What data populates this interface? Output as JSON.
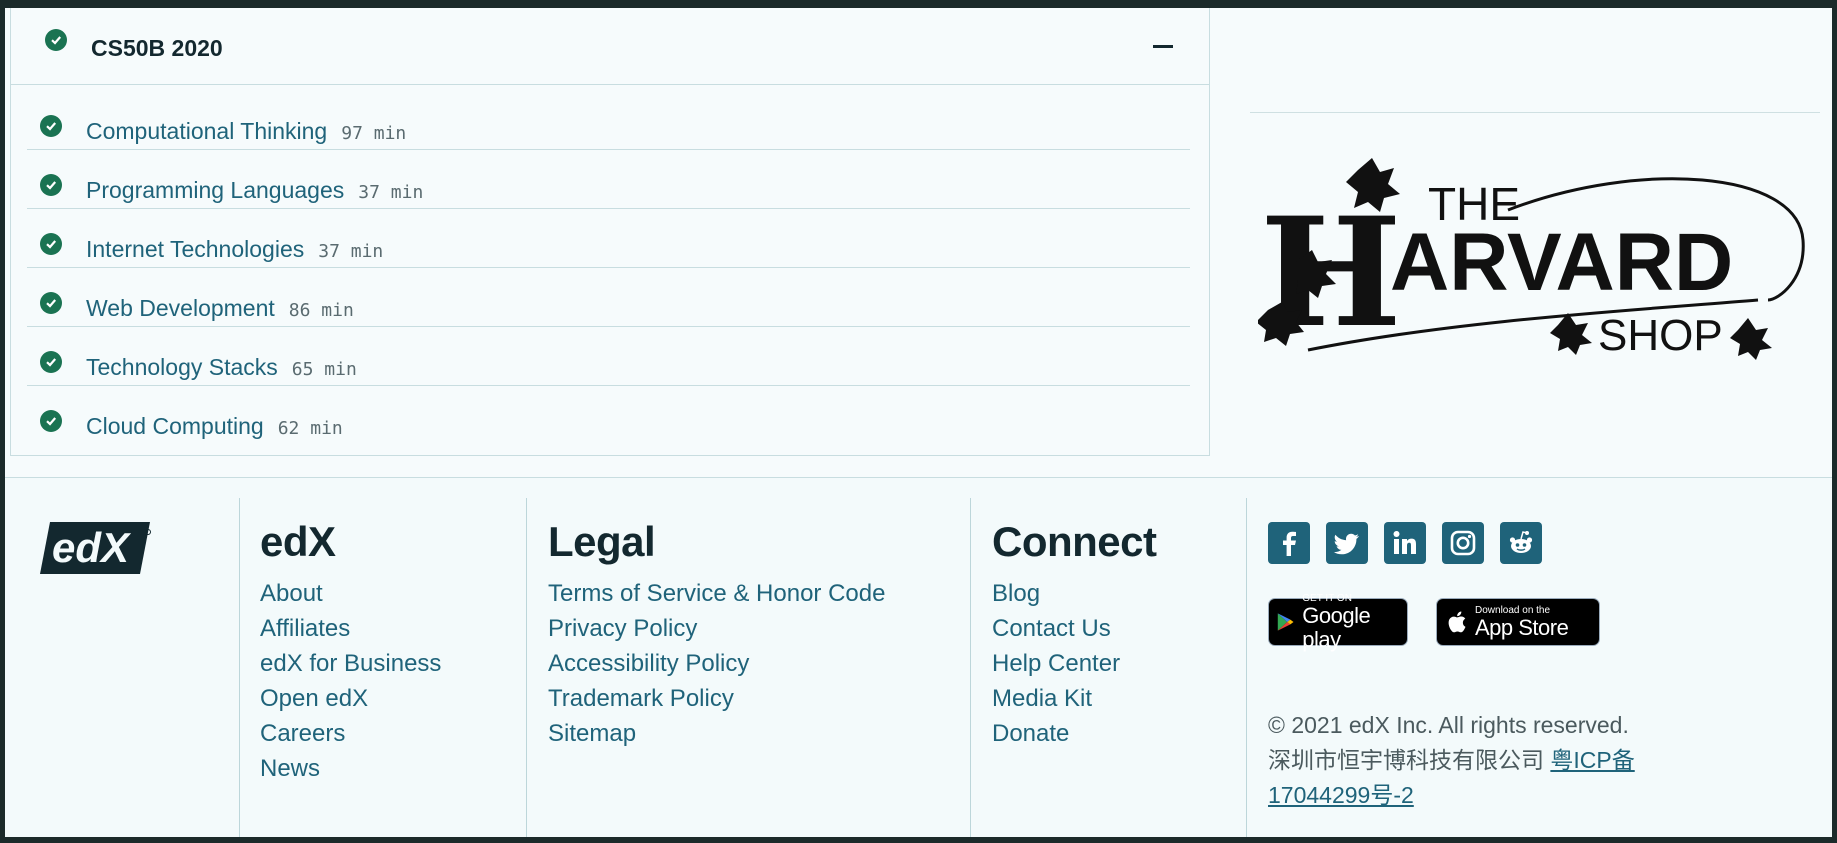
{
  "course": {
    "title": "CS50B 2020",
    "lessons": [
      {
        "title": "Computational Thinking",
        "duration": "97 min"
      },
      {
        "title": "Programming Languages",
        "duration": "37 min"
      },
      {
        "title": "Internet Technologies",
        "duration": "37 min"
      },
      {
        "title": "Web Development",
        "duration": "86 min"
      },
      {
        "title": "Technology Stacks",
        "duration": "65 min"
      },
      {
        "title": "Cloud Computing",
        "duration": "62 min"
      }
    ]
  },
  "shop_logo": {
    "the": "THE",
    "word": "ARVARD",
    "h": "H",
    "shop": "SHOP"
  },
  "footer": {
    "logo_text": "edX",
    "edx": {
      "heading": "edX",
      "links": [
        "About",
        "Affiliates",
        "edX for Business",
        "Open edX",
        "Careers",
        "News"
      ]
    },
    "legal": {
      "heading": "Legal",
      "links": [
        "Terms of Service & Honor Code",
        "Privacy Policy",
        "Accessibility Policy",
        "Trademark Policy",
        "Sitemap"
      ]
    },
    "connect": {
      "heading": "Connect",
      "links": [
        "Blog",
        "Contact Us",
        "Help Center",
        "Media Kit",
        "Donate"
      ]
    },
    "social_icons": [
      "facebook-icon",
      "twitter-icon",
      "linkedin-icon",
      "instagram-icon",
      "reddit-icon"
    ],
    "google_play": {
      "small": "GET IT ON",
      "big": "Google play"
    },
    "app_store": {
      "small": "Download on the",
      "big": "App Store"
    },
    "copyright": "© 2021 edX Inc. All rights reserved.",
    "company": "深圳市恒宇博科技有限公司",
    "icp_link": "粤ICP备17044299号-2"
  },
  "colors": {
    "accent": "#1f637a",
    "check": "#1a7352",
    "text": "#13282f"
  }
}
